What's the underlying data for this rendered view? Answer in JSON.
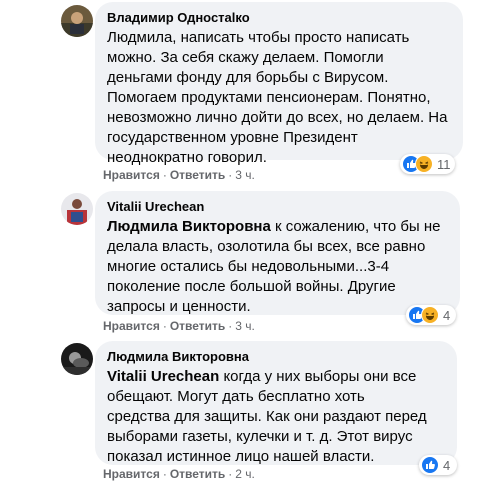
{
  "comments": [
    {
      "author": "Владимир Одностalко",
      "lines": [
        "Людмила, написать чтобы просто написать",
        "можно. За себя скажу делаем. Помогли",
        "деньгами фонду для борьбы с Вирусом.",
        "Помогаем продуктами пенсионерам. Понятно,",
        "невозможно лично дойти до всех, но делаем. На",
        "государственном уровне Президент",
        "неоднократно говорил."
      ],
      "like_label": "Нравится",
      "reply_label": "Ответить",
      "time": "3 ч.",
      "reaction_count": "11",
      "reaction_icons": [
        "like-icon",
        "haha-icon"
      ]
    },
    {
      "author": "Vitalii Urechean",
      "mention": "Людмила Викторовна",
      "lines": [
        " к сожалению, что бы не",
        "делала власть, озолотила бы всех, все равно",
        "многие остались бы недовольными...3-4",
        "поколение после большой войны. Другие",
        "запросы и ценности."
      ],
      "like_label": "Нравится",
      "reply_label": "Ответить",
      "time": "3 ч.",
      "reaction_count": "4",
      "reaction_icons": [
        "like-icon",
        "haha-icon"
      ]
    },
    {
      "author": "Людмила Викторовна",
      "mention": "Vitalii Urechean",
      "lines": [
        " когда у них выборы они все",
        "обещают. Могут дать бесплатно хоть",
        "средства для защиты. Как они раздают перед",
        "выборами газеты, кулечки и т. д. Этот вирус",
        "показал истинное лицо нашей власти."
      ],
      "like_label": "Нравится",
      "reply_label": "Ответить",
      "time": "2 ч.",
      "reaction_count": "4",
      "reaction_icons": [
        "like-icon"
      ]
    }
  ],
  "colors": {
    "bubble": "#f0f2f5",
    "meta": "#65676b",
    "like": "#1877f2",
    "haha": "#f7b125"
  }
}
